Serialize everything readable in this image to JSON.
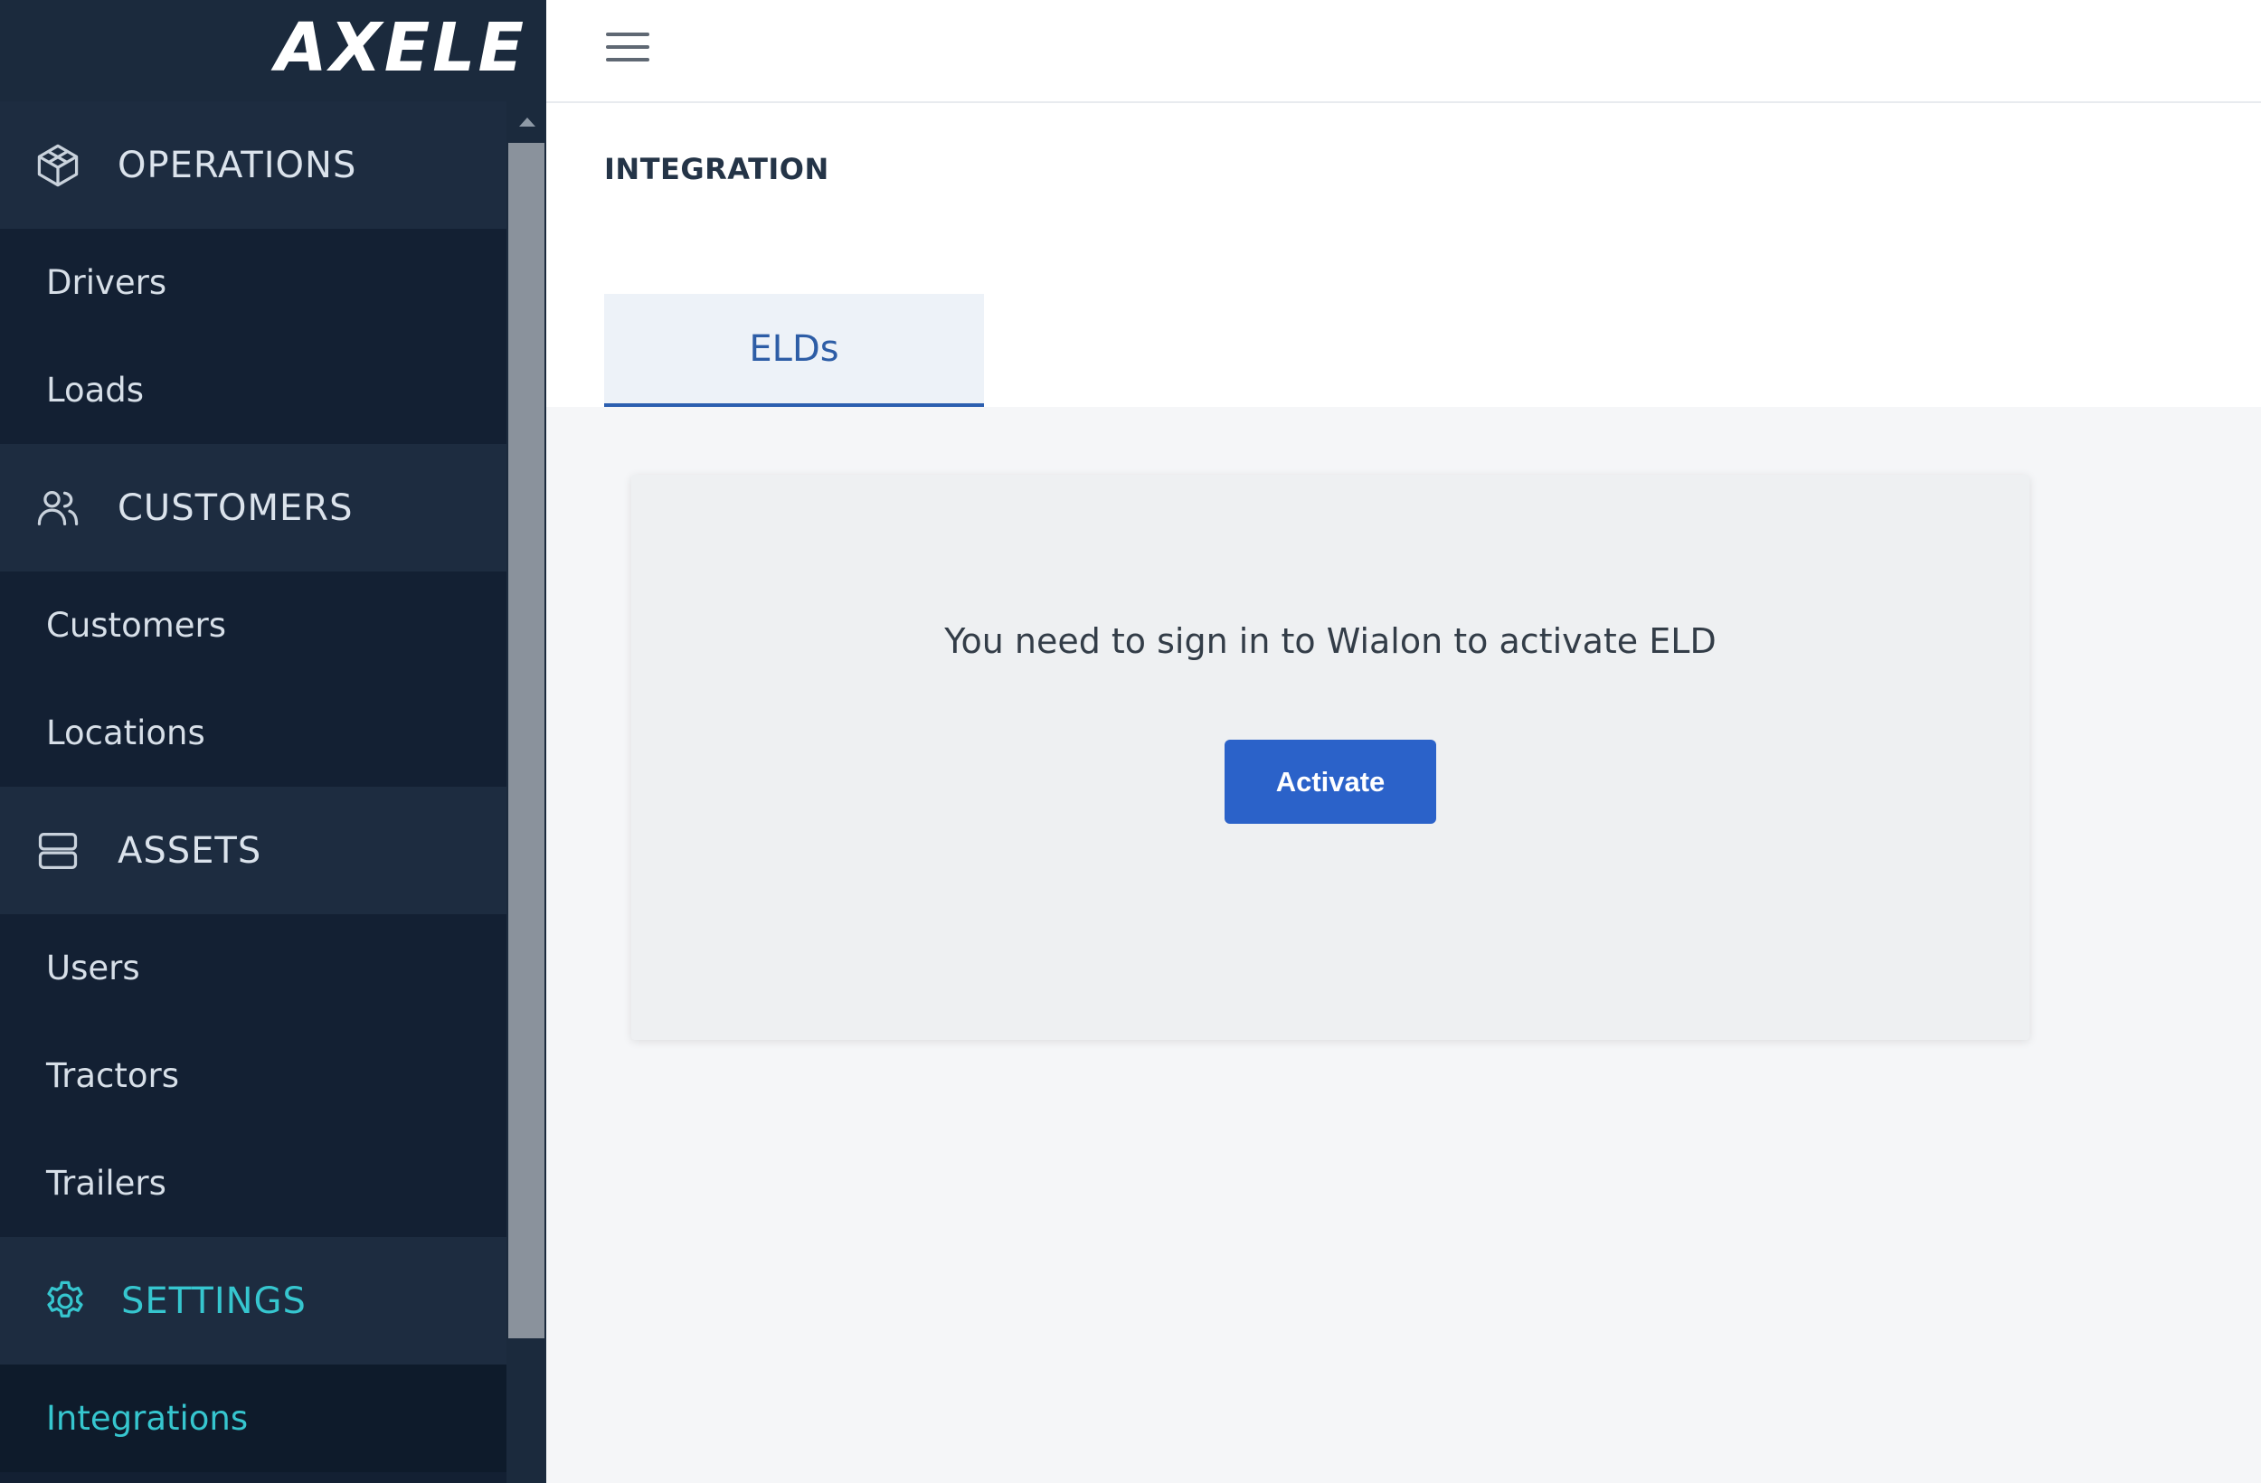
{
  "app": {
    "logo_text": "AXELE"
  },
  "sidebar": {
    "sections": [
      {
        "label": "OPERATIONS",
        "icon": "operations-cube-icon",
        "items": [
          {
            "label": "Drivers"
          },
          {
            "label": "Loads"
          }
        ]
      },
      {
        "label": "CUSTOMERS",
        "icon": "users-icon",
        "items": [
          {
            "label": "Customers"
          },
          {
            "label": "Locations"
          }
        ]
      },
      {
        "label": "ASSETS",
        "icon": "server-icon",
        "items": [
          {
            "label": "Users"
          },
          {
            "label": "Tractors"
          },
          {
            "label": "Trailers"
          }
        ]
      },
      {
        "label": "SETTINGS",
        "icon": "gear-icon",
        "active": true,
        "items": [
          {
            "label": "Integrations",
            "active": true
          }
        ]
      }
    ]
  },
  "topbar": {
    "menu_icon": "hamburger-menu-icon"
  },
  "main": {
    "title": "INTEGRATION",
    "tabs": [
      {
        "label": "ELDs",
        "active": true
      }
    ],
    "card": {
      "message": "You need to sign in to Wialon to activate ELD",
      "button_label": "Activate"
    }
  },
  "colors": {
    "sidebar_bg": "#132033",
    "sidebar_section_bg": "#1d2c40",
    "accent_teal": "#36c6cf",
    "primary_button": "#2b62c9",
    "tab_text": "#2d5da6"
  }
}
